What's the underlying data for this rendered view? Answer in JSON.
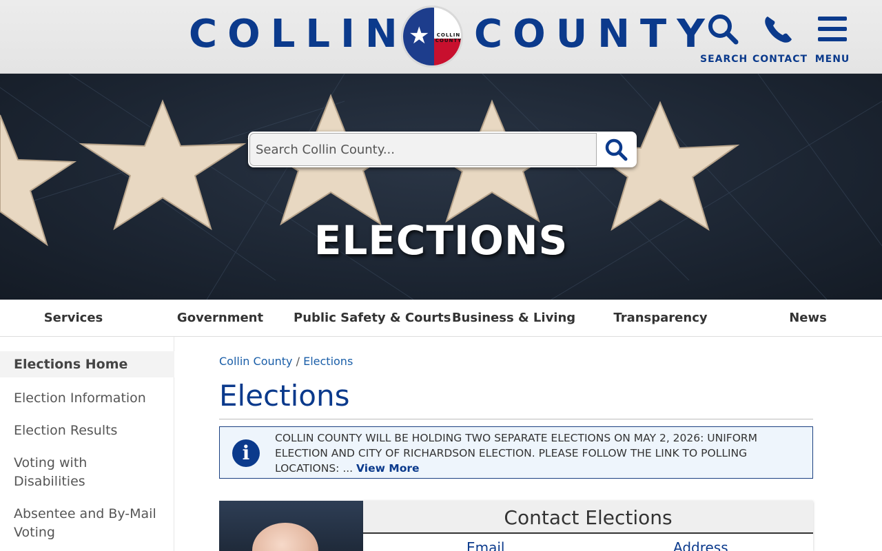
{
  "header": {
    "logo_left": "COLLIN",
    "logo_right": "COUNTY",
    "seal_text_1": "COLLIN",
    "seal_text_2": "COUNTY",
    "search_label": "SEARCH",
    "contact_label": "CONTACT",
    "menu_label": "MENU"
  },
  "hero": {
    "search_placeholder": "Search Collin County...",
    "title": "ELECTIONS"
  },
  "nav": {
    "items": [
      {
        "label": "Services"
      },
      {
        "label": "Government"
      },
      {
        "label": "Public Safety & Courts"
      },
      {
        "label": "Business & Living"
      },
      {
        "label": "Transparency"
      },
      {
        "label": "News"
      }
    ]
  },
  "sidebar": {
    "items": [
      {
        "label": "Elections Home"
      },
      {
        "label": "Election Information"
      },
      {
        "label": "Election Results"
      },
      {
        "label": "Voting with Disabilities"
      },
      {
        "label": "Absentee and By-Mail Voting"
      }
    ]
  },
  "breadcrumb": {
    "root": "Collin County",
    "separator": "/",
    "current": "Elections"
  },
  "main": {
    "title": "Elections",
    "alert_text": "COLLIN COUNTY WILL BE HOLDING TWO SEPARATE ELECTIONS ON MAY 2, 2026: UNIFORM ELECTION AND CITY OF RICHARDSON ELECTION. PLEASE FOLLOW THE LINK TO POLLING LOCATIONS: ...",
    "alert_link": "View More",
    "contact_title": "Contact Elections",
    "contact_col_1": "Email",
    "contact_col_2": "Address"
  },
  "colors": {
    "brand_blue": "#0b3a8c",
    "link_blue": "#1a5ea8",
    "alert_bg": "#eef5fc"
  }
}
